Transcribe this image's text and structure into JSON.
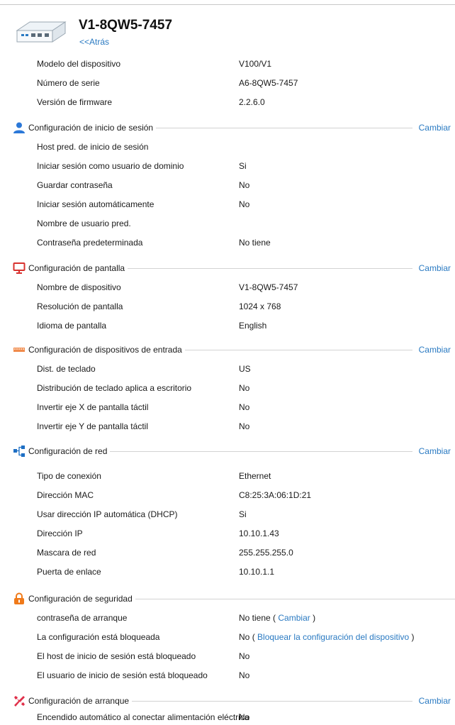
{
  "device": {
    "title": "V1-8QW5-7457",
    "back_label": "<<Atrás",
    "info": [
      {
        "label": "Modelo del dispositivo",
        "value": "V100/V1"
      },
      {
        "label": "Número de serie",
        "value": "A6-8QW5-7457"
      },
      {
        "label": "Versión de firmware",
        "value": "2.2.6.0"
      }
    ]
  },
  "change_label": "Cambiar",
  "sections": {
    "login": {
      "title": "Configuración de inicio de sesión",
      "icon": "user-icon",
      "rows": [
        {
          "label": "Host pred. de inicio de sesión",
          "value": ""
        },
        {
          "label": "Iniciar sesión como usuario de dominio",
          "value": "Si"
        },
        {
          "label": "Guardar contraseña",
          "value": "No"
        },
        {
          "label": "Iniciar sesión automáticamente",
          "value": "No"
        },
        {
          "label": "Nombre de usuario pred.",
          "value": ""
        },
        {
          "label": "Contraseña predeterminada",
          "value": "No tiene"
        }
      ]
    },
    "display": {
      "title": "Configuración de pantalla",
      "icon": "monitor-icon",
      "rows": [
        {
          "label": "Nombre de dispositivo",
          "value": "V1-8QW5-7457"
        },
        {
          "label": "Resolución de pantalla",
          "value": "1024 x 768"
        },
        {
          "label": "Idioma de pantalla",
          "value": "English"
        }
      ]
    },
    "input": {
      "title": "Configuración de dispositivos de entrada",
      "icon": "keyboard-icon",
      "rows": [
        {
          "label": "Dist. de teclado",
          "value": "US"
        },
        {
          "label": "Distribución de teclado aplica a escritorio",
          "value": "No"
        },
        {
          "label": "Invertir eje X de pantalla táctil",
          "value": "No"
        },
        {
          "label": "Invertir eje Y de pantalla táctil",
          "value": "No"
        }
      ]
    },
    "network": {
      "title": "Configuración de red",
      "icon": "network-icon",
      "rows": [
        {
          "label": "Tipo de conexión",
          "value": "Ethernet"
        },
        {
          "label": "Dirección MAC",
          "value": "C8:25:3A:06:1D:21"
        },
        {
          "label": "Usar dirección IP automática (DHCP)",
          "value": "Si"
        },
        {
          "label": "Dirección IP",
          "value": "10.10.1.43"
        },
        {
          "label": "Mascara de red",
          "value": "255.255.255.0"
        },
        {
          "label": "Puerta de enlace",
          "value": "10.10.1.1"
        }
      ]
    },
    "security": {
      "title": "Configuración de seguridad",
      "icon": "lock-icon",
      "boot_password_label": "contraseña de arranque",
      "boot_password_value": "No tiene",
      "boot_password_link": "Cambiar",
      "locked_label": "La configuración está bloqueada",
      "locked_value": "No",
      "locked_link": "Bloquear la configuración del dispositivo",
      "open_paren": "(",
      "close_paren": ")",
      "rows": [
        {
          "label": "El host de inicio de sesión está bloqueado",
          "value": "No"
        },
        {
          "label": "El usuario de inicio de sesión está bloqueado",
          "value": "No"
        }
      ]
    },
    "boot": {
      "title": "Configuración de arranque",
      "icon": "tools-icon",
      "rows": [
        {
          "label": "Encendido automático al conectar alimentación eléctrica",
          "value": "No"
        }
      ]
    }
  },
  "colors": {
    "link": "#2a7ac2",
    "user": "#2b78d8",
    "monitor": "#d8312e",
    "keyboard": "#f08a4b",
    "network": "#1e6fc4",
    "lock": "#f07a1a",
    "tools": "#e0304a"
  }
}
